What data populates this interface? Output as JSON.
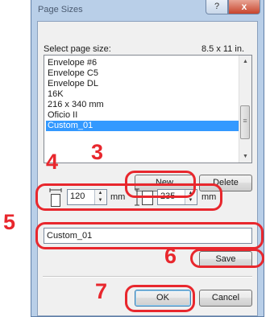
{
  "dialog": {
    "title": "Page Sizes",
    "help_label": "?",
    "close_label": "x"
  },
  "page_size": {
    "label": "Select page size:",
    "current_dimensions": "8.5 x 11 in.",
    "items": [
      "Envelope #6",
      "Envelope C5",
      "Envelope DL",
      "16K",
      "216 x 340 mm",
      "Oficio II",
      "Custom_01"
    ],
    "selected": "Custom_01"
  },
  "buttons": {
    "new": "New",
    "delete": "Delete",
    "save": "Save",
    "ok": "OK",
    "cancel": "Cancel"
  },
  "dimensions": {
    "width_value": "120",
    "width_unit": "mm",
    "height_value": "235",
    "height_unit": "mm"
  },
  "custom_name": {
    "value": "Custom_01"
  },
  "callouts": {
    "step3": "3",
    "step4": "4",
    "step5": "5",
    "step6": "6",
    "step7": "7"
  },
  "colors": {
    "highlight": "#e8272d",
    "selection": "#3399ff"
  }
}
